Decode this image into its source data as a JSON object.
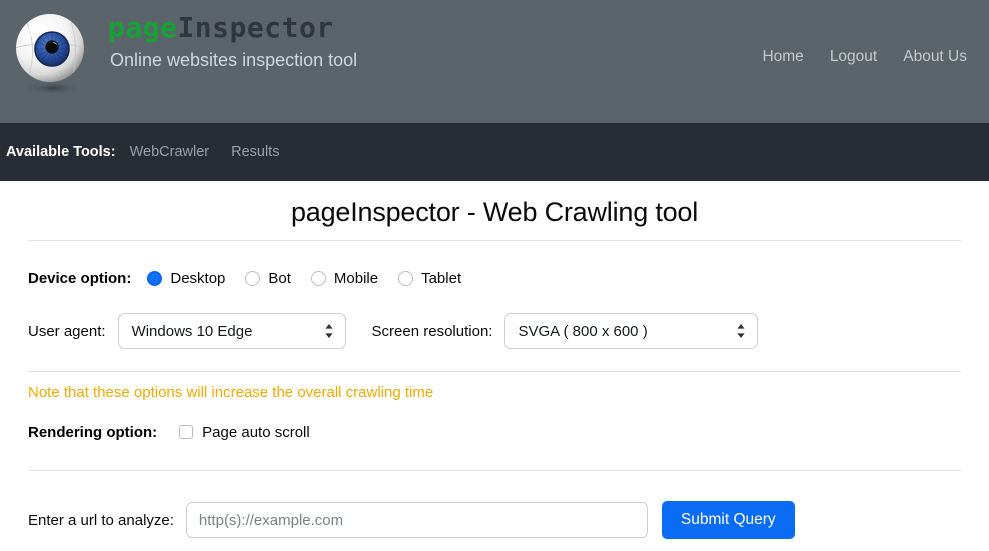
{
  "header": {
    "brand_page": "page",
    "brand_inspector": "Inspector",
    "subtitle": "Online websites inspection tool",
    "logo_icon": "eyeball-icon",
    "nav": [
      {
        "label": "Home"
      },
      {
        "label": "Logout"
      },
      {
        "label": "About Us"
      }
    ]
  },
  "toolbar": {
    "label": "Available Tools:",
    "tools": [
      {
        "label": "WebCrawler"
      },
      {
        "label": "Results"
      }
    ]
  },
  "main": {
    "title": "pageInspector - Web Crawling tool",
    "device": {
      "label": "Device option:",
      "options": [
        {
          "label": "Desktop",
          "selected": true
        },
        {
          "label": "Bot",
          "selected": false
        },
        {
          "label": "Mobile",
          "selected": false
        },
        {
          "label": "Tablet",
          "selected": false
        }
      ]
    },
    "user_agent": {
      "label": "User agent:",
      "value": "Windows 10 Edge",
      "icon": "stepper-updown-icon"
    },
    "screen_resolution": {
      "label": "Screen resolution:",
      "value": "SVGA ( 800 x 600 )",
      "icon": "stepper-updown-icon"
    },
    "note": "Note that these options will increase the overall crawling time",
    "rendering": {
      "label": "Rendering option:",
      "checkbox_label": "Page auto scroll",
      "checked": false
    },
    "url": {
      "label": "Enter a url to analyze:",
      "placeholder": "http(s)://example.com",
      "value": "",
      "submit_label": "Submit Query"
    }
  },
  "colors": {
    "header_bg": "#5b646b",
    "toolbar_bg": "#282c34",
    "brand_green": "#16a237",
    "accent_blue": "#0a6bf5",
    "note_amber": "#f0ab00"
  }
}
